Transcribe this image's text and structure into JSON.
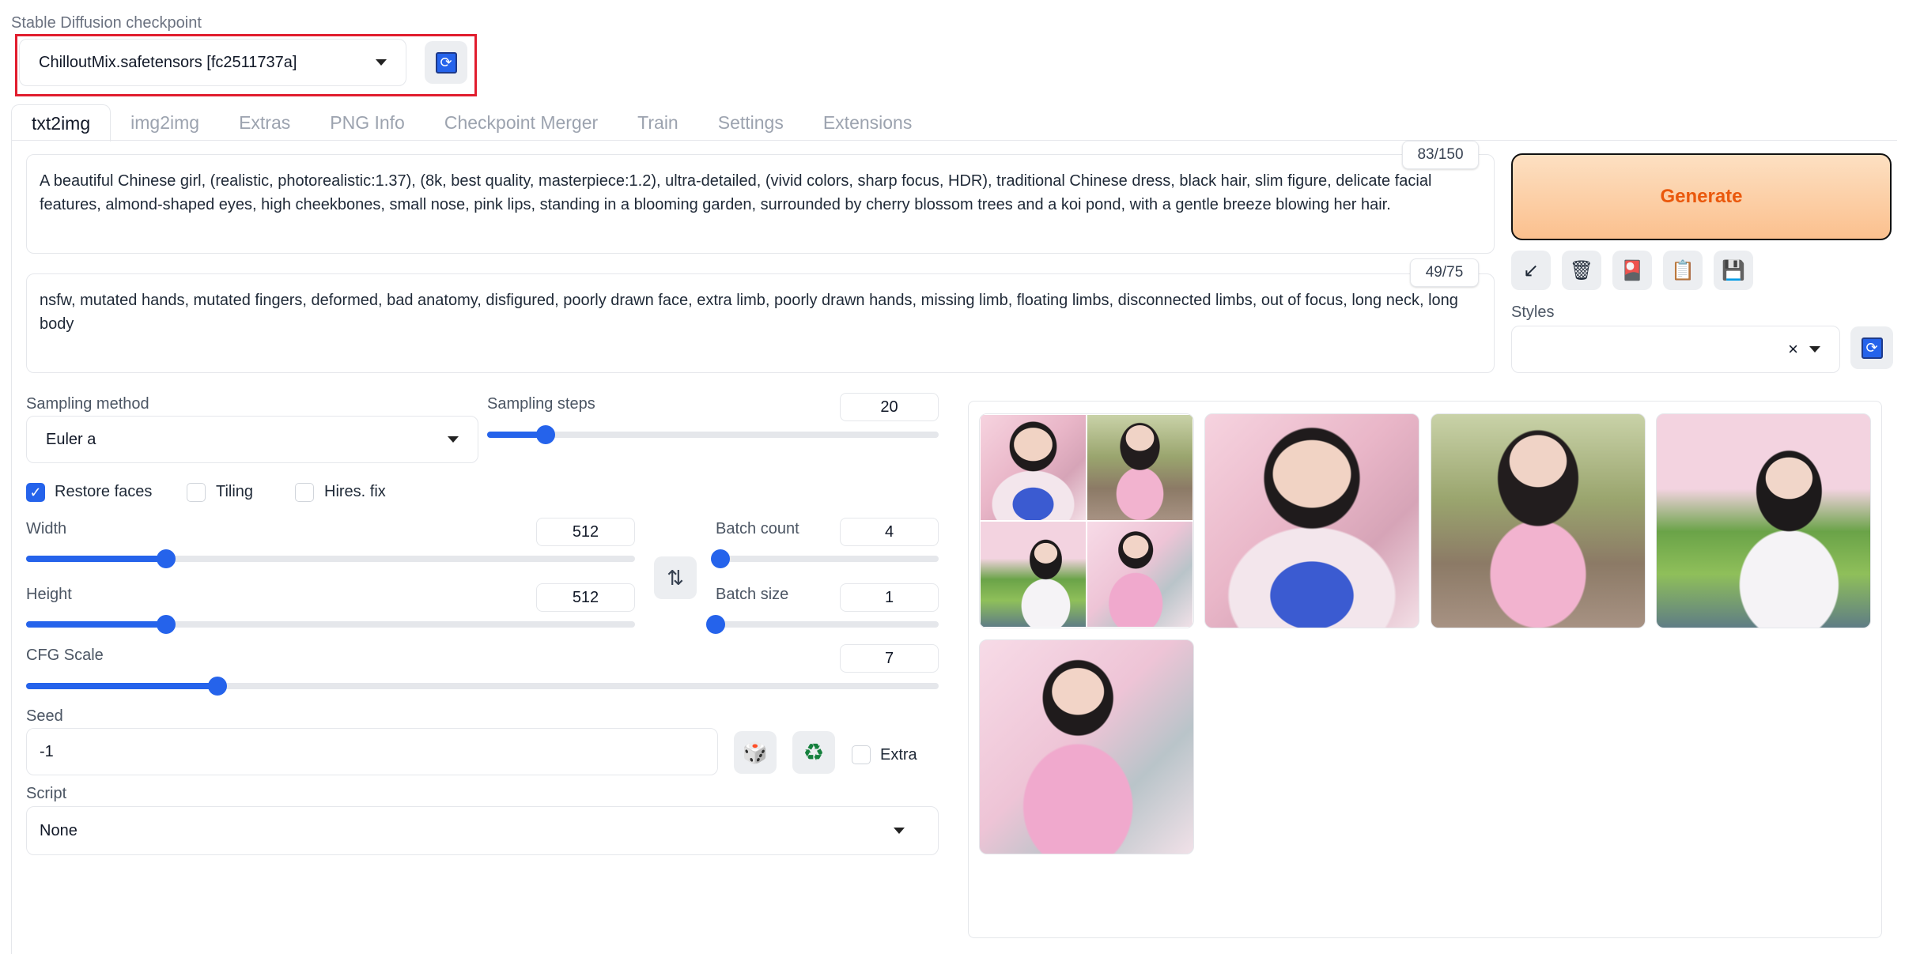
{
  "checkpoint": {
    "label": "Stable Diffusion checkpoint",
    "value": "ChilloutMix.safetensors [fc2511737a]",
    "refresh_icon": "refresh-icon"
  },
  "tabs": [
    {
      "label": "txt2img",
      "active": true
    },
    {
      "label": "img2img"
    },
    {
      "label": "Extras"
    },
    {
      "label": "PNG Info"
    },
    {
      "label": "Checkpoint Merger"
    },
    {
      "label": "Train"
    },
    {
      "label": "Settings"
    },
    {
      "label": "Extensions"
    }
  ],
  "prompt": {
    "text": "A beautiful Chinese girl, (realistic, photorealistic:1.37), (8k, best quality, masterpiece:1.2), ultra-detailed, (vivid colors, sharp focus, HDR), traditional Chinese dress, black hair, slim figure, delicate facial features, almond-shaped eyes, high cheekbones, small nose, pink lips, standing in a blooming garden, surrounded by cherry blossom trees and a koi pond, with a gentle breeze blowing her hair.",
    "counter": "83/150"
  },
  "negative_prompt": {
    "text": "nsfw, mutated hands, mutated fingers, deformed, bad anatomy, disfigured, poorly drawn face, extra limb, poorly drawn hands, missing limb, floating limbs, disconnected limbs, out of focus, long neck, long body",
    "counter": "49/75"
  },
  "generate": {
    "label": "Generate"
  },
  "tools": {
    "icons": [
      "arrow-icon",
      "trash-icon",
      "red-card-icon",
      "clipboard-icon",
      "save-icon"
    ],
    "glyphs": [
      "↙",
      "🗑",
      "🎴",
      "📋",
      "💾"
    ]
  },
  "styles": {
    "label": "Styles",
    "clear_glyph": "×",
    "refresh_glyph": "⟳"
  },
  "sampling": {
    "method_label": "Sampling method",
    "method_value": "Euler a",
    "steps_label": "Sampling steps",
    "steps_value": "20",
    "steps_fraction": 0.13
  },
  "checkboxes": {
    "restore_faces": {
      "label": "Restore faces",
      "checked": true
    },
    "tiling": {
      "label": "Tiling",
      "checked": false
    },
    "hires_fix": {
      "label": "Hires. fix",
      "checked": false
    }
  },
  "size": {
    "width_label": "Width",
    "width_value": "512",
    "width_fraction": 0.23,
    "height_label": "Height",
    "height_value": "512",
    "height_fraction": 0.23,
    "swap_glyph": "⇅"
  },
  "batch": {
    "count_label": "Batch count",
    "count_value": "4",
    "count_fraction": 0.02,
    "size_label": "Batch size",
    "size_value": "1",
    "size_fraction": 0.0
  },
  "cfg": {
    "label": "CFG Scale",
    "value": "7",
    "fraction": 0.21
  },
  "seed": {
    "label": "Seed",
    "value": "-1",
    "dice_glyph": "🎲",
    "recycle_glyph": "♻",
    "extra_label": "Extra"
  },
  "script": {
    "label": "Script",
    "value": "None"
  },
  "gallery": {
    "images": [
      "grid-preview",
      "image-1",
      "image-2",
      "image-3",
      "image-4"
    ]
  }
}
